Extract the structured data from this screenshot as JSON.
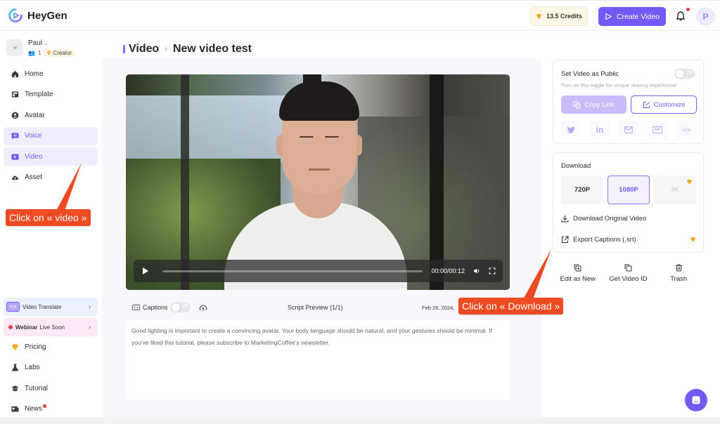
{
  "app": {
    "name": "HeyGen",
    "accent_color": "#7559f7"
  },
  "header": {
    "credits_label": "13.5 Credits",
    "create_video_label": "Create Video",
    "profile_initial": "P",
    "has_notification": true
  },
  "user": {
    "name": "Paul",
    "member_count": "1",
    "plan": "Creator"
  },
  "sidebar": {
    "items": [
      {
        "label": "Home",
        "icon": "home-icon",
        "active": false
      },
      {
        "label": "Template",
        "icon": "template-icon",
        "active": false
      },
      {
        "label": "Avatar",
        "icon": "avatar-icon",
        "active": false
      },
      {
        "label": "Voice",
        "icon": "voice-icon",
        "active": true
      },
      {
        "label": "Video",
        "icon": "video-icon",
        "active": true
      },
      {
        "label": "Asset",
        "icon": "cloud-icon",
        "active": false
      }
    ],
    "promos": [
      {
        "label": "Video Translate",
        "badge": "文/A"
      },
      {
        "label_bold": "Webinar",
        "label": "Live Soon"
      }
    ],
    "bottom_items": [
      {
        "label": "Pricing",
        "icon": "gem-icon"
      },
      {
        "label": "Labs",
        "icon": "flask-icon"
      },
      {
        "label": "Tutorial",
        "icon": "graduation-cap-icon"
      },
      {
        "label": "News",
        "icon": "news-icon",
        "has_dot": true
      }
    ]
  },
  "breadcrumb": {
    "parent": "Video",
    "separator": "›",
    "current": "New video test"
  },
  "player": {
    "time": "00:00/00:12",
    "progress": 0
  },
  "captions": {
    "label": "Captions",
    "toggle_state": "Off"
  },
  "script": {
    "title": "Script Preview (1/1)",
    "date": "Feb 29, 2024,",
    "text": "Good lighting is important to create a convincing avatar. Your body language should be natural, and your gestures should be minimal. If you've liked this tutorial, please subscribe to MarketingCoffee's newsletter."
  },
  "share": {
    "title": "Set Video as Public",
    "toggle_state": "Off",
    "subtitle": "Turn on this toggle for unique sharing experience!",
    "copy_link_label": "Copy Link",
    "customize_label": "Customize",
    "social": [
      {
        "name": "twitter",
        "glyph": "🐦"
      },
      {
        "name": "linkedin",
        "glyph": "in"
      },
      {
        "name": "email",
        "glyph": "✉"
      },
      {
        "name": "gif",
        "glyph": "GIF"
      },
      {
        "name": "embed",
        "glyph": "</>"
      }
    ]
  },
  "download": {
    "title": "Download",
    "resolutions": [
      {
        "label": "720P",
        "selected": false,
        "premium": false
      },
      {
        "label": "1080P",
        "selected": true,
        "premium": false
      },
      {
        "label": "4K",
        "selected": false,
        "premium": true
      }
    ],
    "original_label": "Download Original Video",
    "captions_label": "Export Captions (.srt)"
  },
  "actions": [
    {
      "label": "Edit as New",
      "icon": "duplicate-plus-icon"
    },
    {
      "label": "Get Video ID",
      "icon": "copy-icon"
    },
    {
      "label": "Trash",
      "icon": "trash-icon"
    }
  ],
  "annotations": {
    "callout_video": "Click on « video »",
    "callout_download": "Click on « Download »",
    "color": "#ee4b22"
  }
}
